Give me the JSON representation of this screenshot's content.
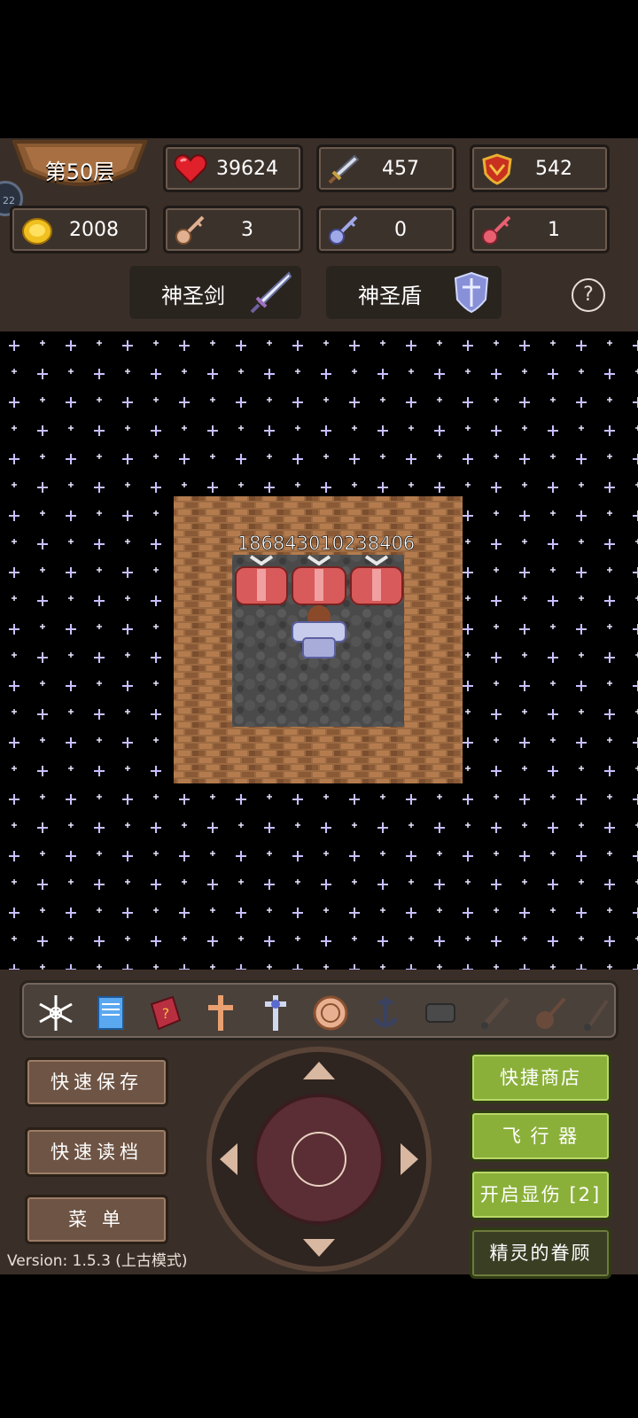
{
  "hud": {
    "floor": "第50层",
    "hp": "39624",
    "attack": "457",
    "defense": "542",
    "gold": "2008",
    "yellow_keys": "3",
    "blue_keys": "0",
    "red_keys": "1",
    "avatar_badge": "22"
  },
  "equipment": {
    "weapon": "神圣剑",
    "armor": "神圣盾",
    "help": "?"
  },
  "board": {
    "damage_label": "18684301023840 6",
    "damage_text": "186843010238406"
  },
  "items": [
    "snowflake-icon",
    "notebook-icon",
    "monster-book-icon",
    "cross-icon",
    "holy-water-icon",
    "coin-icon",
    "anchor-icon",
    "scroll-icon",
    "pickaxe-icon",
    "guitar-icon",
    "staff-icon"
  ],
  "buttons": {
    "quick_save": "快速保存",
    "quick_load": "快速读档",
    "menu": "菜 单",
    "quick_shop": "快捷商店",
    "flyer": "飞 行 器",
    "show_damage": "开启显伤 [2]",
    "spirit_blessing": "精灵的眷顾"
  },
  "version": "Version: 1.5.3 (上古模式)",
  "colors": {
    "hud_bg": "#3a2f28",
    "green_btn": "#8bb03a",
    "brown_btn": "#6e5444"
  }
}
